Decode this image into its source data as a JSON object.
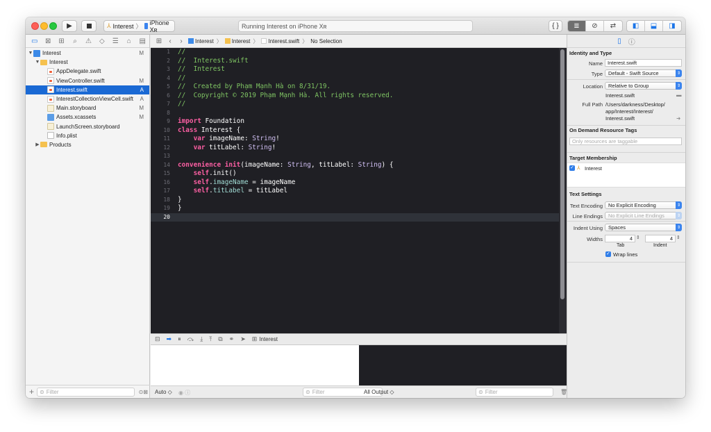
{
  "toolbar": {
    "scheme_target": "Interest",
    "scheme_device": "iPhone Xʀ",
    "status": "Running Interest on iPhone Xʀ",
    "code_symbol": "{ }"
  },
  "navigator": {
    "filter_placeholder": "Filter",
    "items": [
      {
        "label": "Interest",
        "badge": "M",
        "indent": 0,
        "icon": "project-icon",
        "disclosure": "▼"
      },
      {
        "label": "Interest",
        "badge": "",
        "indent": 1,
        "icon": "folder-icon",
        "disclosure": "▼"
      },
      {
        "label": "AppDelegate.swift",
        "badge": "",
        "indent": 2,
        "icon": "swift-file-icon",
        "disclosure": ""
      },
      {
        "label": "ViewController.swift",
        "badge": "M",
        "indent": 2,
        "icon": "swift-file-icon",
        "disclosure": ""
      },
      {
        "label": "Interest.swift",
        "badge": "A",
        "indent": 2,
        "icon": "swift-file-icon",
        "disclosure": "",
        "selected": true
      },
      {
        "label": "InterestCollectionViewCell.swift",
        "badge": "A",
        "indent": 2,
        "icon": "swift-file-icon",
        "disclosure": ""
      },
      {
        "label": "Main.storyboard",
        "badge": "M",
        "indent": 2,
        "icon": "storyboard-icon",
        "disclosure": ""
      },
      {
        "label": "Assets.xcassets",
        "badge": "M",
        "indent": 2,
        "icon": "assets-icon",
        "disclosure": ""
      },
      {
        "label": "LaunchScreen.storyboard",
        "badge": "",
        "indent": 2,
        "icon": "storyboard-icon",
        "disclosure": ""
      },
      {
        "label": "Info.plist",
        "badge": "",
        "indent": 2,
        "icon": "plist-icon",
        "disclosure": ""
      },
      {
        "label": "Products",
        "badge": "",
        "indent": 1,
        "icon": "folder-icon",
        "disclosure": "▶"
      }
    ]
  },
  "jumpbar": {
    "crumb1": "Interest",
    "crumb2": "Interest",
    "crumb3": "Interest.swift",
    "crumb4": "No Selection"
  },
  "editor": {
    "current_line": 20,
    "lines": [
      [
        {
          "t": "//",
          "c": "cmt"
        }
      ],
      [
        {
          "t": "//  Interest.swift",
          "c": "cmt"
        }
      ],
      [
        {
          "t": "//  Interest",
          "c": "cmt"
        }
      ],
      [
        {
          "t": "//",
          "c": "cmt"
        }
      ],
      [
        {
          "t": "//  Created by Phạm Mạnh Hà on 8/31/19.",
          "c": "cmt"
        }
      ],
      [
        {
          "t": "//  Copyright © 2019 Phạm Mạnh Hà. All rights reserved.",
          "c": "cmt"
        }
      ],
      [
        {
          "t": "//",
          "c": "cmt"
        }
      ],
      [],
      [
        {
          "t": "import",
          "c": "kw"
        },
        {
          "t": " Foundation",
          "c": ""
        }
      ],
      [
        {
          "t": "class",
          "c": "kw"
        },
        {
          "t": " Interest {",
          "c": ""
        }
      ],
      [
        {
          "t": "    ",
          "c": ""
        },
        {
          "t": "var",
          "c": "kw"
        },
        {
          "t": " imageName: ",
          "c": ""
        },
        {
          "t": "String",
          "c": "ty"
        },
        {
          "t": "!",
          "c": ""
        }
      ],
      [
        {
          "t": "    ",
          "c": ""
        },
        {
          "t": "var",
          "c": "kw"
        },
        {
          "t": " titLabel: ",
          "c": ""
        },
        {
          "t": "String",
          "c": "ty"
        },
        {
          "t": "!",
          "c": ""
        }
      ],
      [],
      [
        {
          "t": "convenience",
          "c": "kw"
        },
        {
          "t": " ",
          "c": ""
        },
        {
          "t": "init",
          "c": "kw"
        },
        {
          "t": "(imageName: ",
          "c": ""
        },
        {
          "t": "String",
          "c": "ty"
        },
        {
          "t": ", titLabel: ",
          "c": ""
        },
        {
          "t": "String",
          "c": "ty"
        },
        {
          "t": ") {",
          "c": ""
        }
      ],
      [
        {
          "t": "    ",
          "c": ""
        },
        {
          "t": "self",
          "c": "kw"
        },
        {
          "t": ".init()",
          "c": ""
        }
      ],
      [
        {
          "t": "    ",
          "c": ""
        },
        {
          "t": "self",
          "c": "kw"
        },
        {
          "t": ".",
          "c": ""
        },
        {
          "t": "imageName",
          "c": "prop"
        },
        {
          "t": " = imageName",
          "c": ""
        }
      ],
      [
        {
          "t": "    ",
          "c": ""
        },
        {
          "t": "self",
          "c": "kw"
        },
        {
          "t": ".",
          "c": ""
        },
        {
          "t": "titLabel",
          "c": "prop"
        },
        {
          "t": " = titLabel",
          "c": ""
        }
      ],
      [
        {
          "t": "}",
          "c": ""
        }
      ],
      [
        {
          "t": "}",
          "c": ""
        }
      ],
      []
    ]
  },
  "debug": {
    "target": "Interest",
    "vars_mode": "Auto ◇",
    "filter_placeholder": "Filter",
    "output_mode": "All Output ◇"
  },
  "inspector": {
    "identity_title": "Identity and Type",
    "name_label": "Name",
    "name_value": "Interest.swift",
    "type_label": "Type",
    "type_value": "Default - Swift Source",
    "location_label": "Location",
    "location_value": "Relative to Group",
    "location_file": "Interest.swift",
    "fullpath_label": "Full Path",
    "fullpath_value_1": "/Users/darkness/Desktop/",
    "fullpath_value_2": "app/Interest/Interest/",
    "fullpath_value_3": "Interest.swift",
    "odr_title": "On Demand Resource Tags",
    "odr_placeholder": "Only resources are taggable",
    "target_title": "Target Membership",
    "target_item": "Interest",
    "text_title": "Text Settings",
    "encoding_label": "Text Encoding",
    "encoding_value": "No Explicit Encoding",
    "endings_label": "Line Endings",
    "endings_value": "No Explicit Line Endings",
    "indent_label": "Indent Using",
    "indent_value": "Spaces",
    "widths_label": "Widths",
    "tab_value": "4",
    "indent_width_value": "4",
    "tab_caption": "Tab",
    "indent_caption": "Indent",
    "wrap_label": "Wrap lines"
  }
}
